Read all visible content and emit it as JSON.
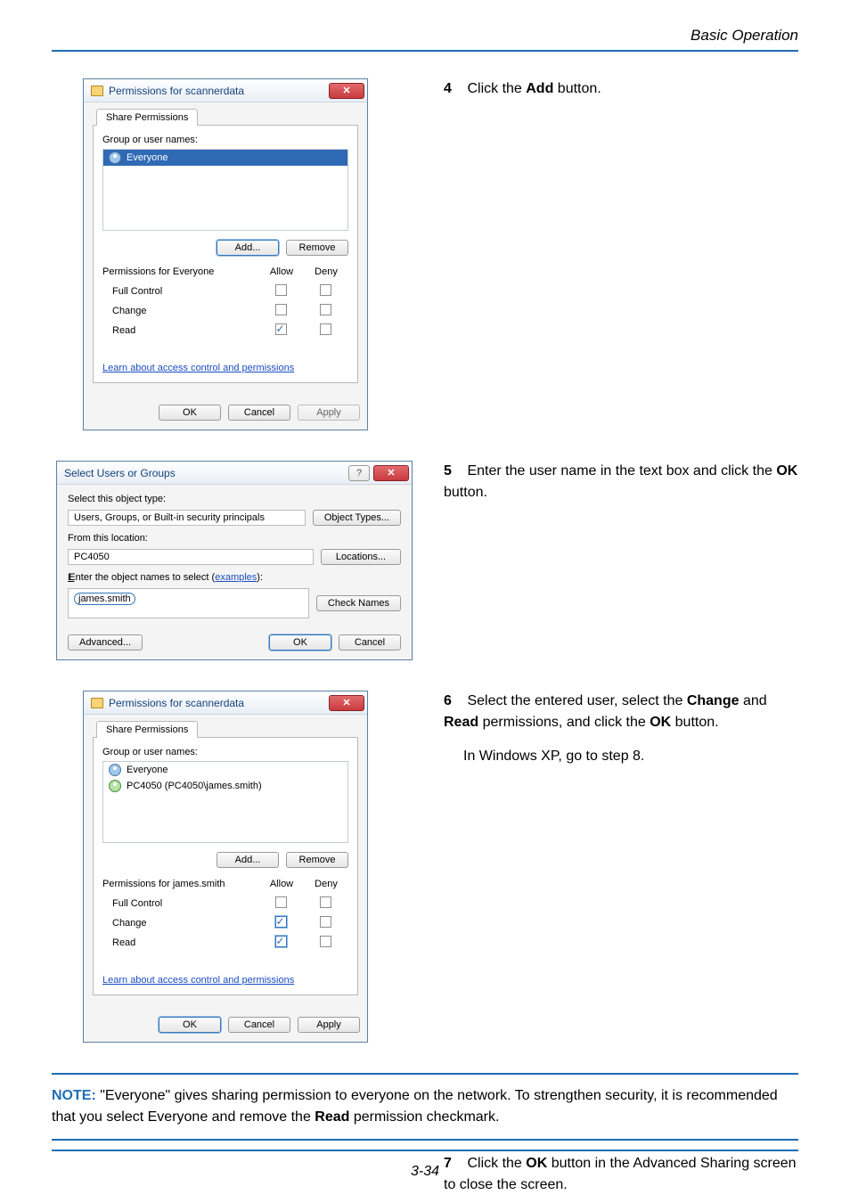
{
  "header": {
    "section_title": "Basic Operation"
  },
  "step4": {
    "num": "4",
    "text_a": "Click the ",
    "text_b": "Add",
    "text_c": " button."
  },
  "step5": {
    "num": "5",
    "text_a": "Enter the user name in the text box and click the ",
    "text_b": "OK",
    "text_c": " button."
  },
  "step6": {
    "num": "6",
    "text_a": "Select the entered user, select the ",
    "text_b": "Change",
    "text_c": " and ",
    "text_d": "Read",
    "text_e": " permissions, and click the ",
    "text_f": "OK",
    "text_g": " button.",
    "text_xp": "In Windows XP, go to step 8."
  },
  "step7": {
    "num": "7",
    "text_a": "Click the ",
    "text_b": "OK",
    "text_c": " button in the Advanced Sharing screen to close the screen."
  },
  "note": {
    "label": "NOTE:",
    "text_a": " \"Everyone\" gives sharing permission to everyone on the network. To strengthen security, it is recommended that you select Everyone and remove the ",
    "text_b": "Read",
    "text_c": " permission checkmark."
  },
  "dlg1": {
    "title": "Permissions for scannerdata",
    "tab": "Share Permissions",
    "group_label": "Group or user names:",
    "user": "Everyone",
    "add": "Add...",
    "remove": "Remove",
    "perm_header": "Permissions for Everyone",
    "allow": "Allow",
    "deny": "Deny",
    "p_full": "Full Control",
    "p_change": "Change",
    "p_read": "Read",
    "link": "Learn about access control and permissions",
    "ok": "OK",
    "cancel": "Cancel",
    "apply": "Apply"
  },
  "dlg2": {
    "title": "Select Users or Groups",
    "object_type_label": "Select this object type:",
    "object_type": "Users, Groups, or Built-in security principals",
    "object_btn": "Object Types...",
    "location_label": "From this location:",
    "location": "PC4050",
    "location_btn": "Locations...",
    "enter_label_a": "Enter the object names to select (",
    "enter_label_b": "examples",
    "enter_label_c": "):",
    "entered": "james.smith",
    "check_btn": "Check Names",
    "advanced": "Advanced...",
    "ok": "OK",
    "cancel": "Cancel"
  },
  "dlg3": {
    "title": "Permissions for scannerdata",
    "tab": "Share Permissions",
    "group_label": "Group or user names:",
    "user1": "Everyone",
    "user2": "PC4050 (PC4050\\james.smith)",
    "add": "Add...",
    "remove": "Remove",
    "perm_header": "Permissions for  james.smith",
    "allow": "Allow",
    "deny": "Deny",
    "p_full": "Full Control",
    "p_change": "Change",
    "p_read": "Read",
    "link": "Learn about access control and permissions",
    "ok": "OK",
    "cancel": "Cancel",
    "apply": "Apply"
  },
  "footer": {
    "page": "3-34"
  }
}
